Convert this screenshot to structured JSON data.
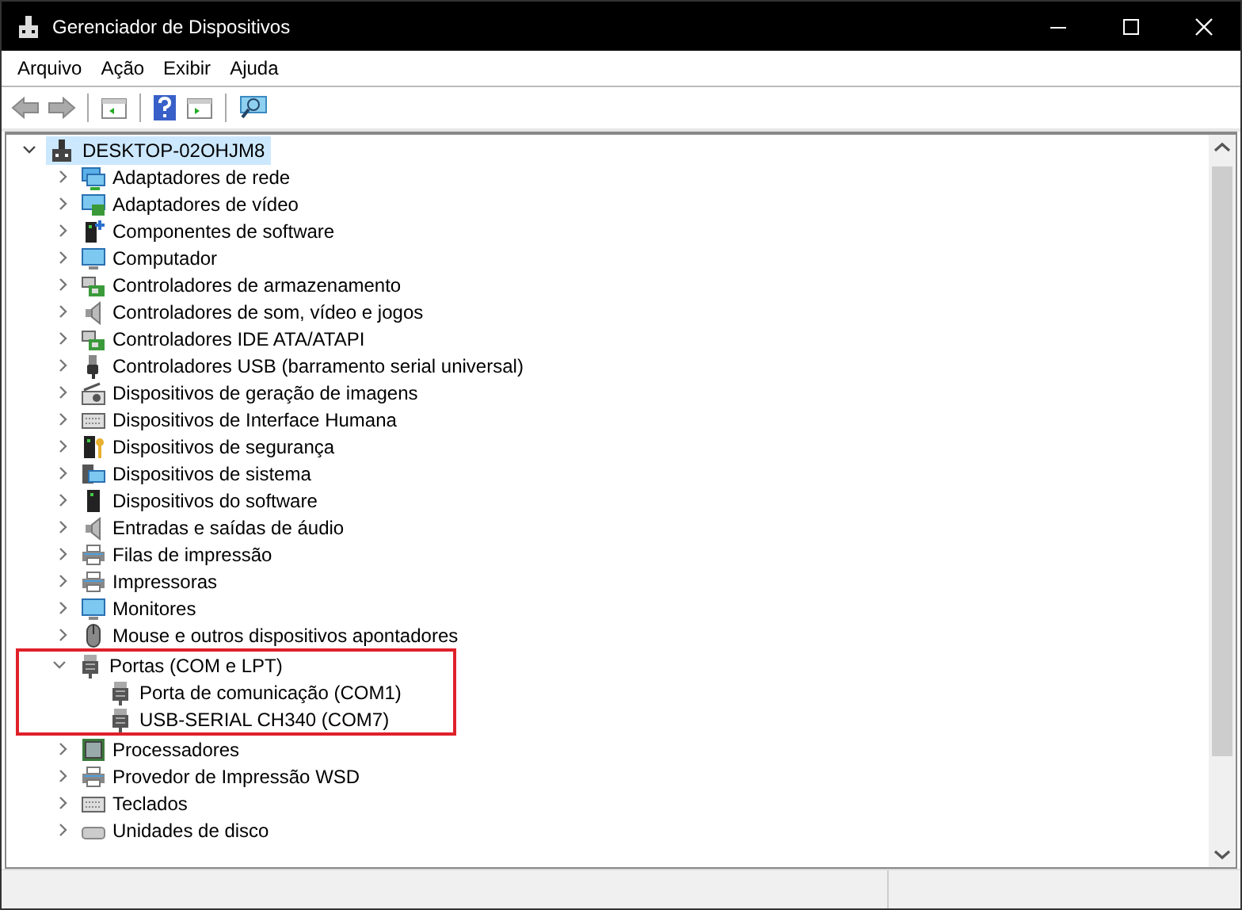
{
  "window": {
    "title": "Gerenciador de Dispositivos"
  },
  "menu": [
    "Arquivo",
    "Ação",
    "Exibir",
    "Ajuda"
  ],
  "tree": {
    "label": "DESKTOP-02OHJM8",
    "selected": true,
    "expanded": true,
    "children": [
      {
        "label": "Adaptadores de rede",
        "kind": "network",
        "expanded": false,
        "highlighted": false
      },
      {
        "label": "Adaptadores de vídeo",
        "kind": "display",
        "expanded": false,
        "highlighted": false
      },
      {
        "label": "Componentes de software",
        "kind": "component",
        "expanded": false,
        "highlighted": false
      },
      {
        "label": "Computador",
        "kind": "monitor",
        "expanded": false,
        "highlighted": false
      },
      {
        "label": "Controladores de armazenamento",
        "kind": "storage",
        "expanded": false,
        "highlighted": false
      },
      {
        "label": "Controladores de som, vídeo e jogos",
        "kind": "speaker",
        "expanded": false,
        "highlighted": false
      },
      {
        "label": "Controladores IDE ATA/ATAPI",
        "kind": "card",
        "expanded": false,
        "highlighted": false
      },
      {
        "label": "Controladores USB (barramento serial universal)",
        "kind": "usb",
        "expanded": false,
        "highlighted": false
      },
      {
        "label": "Dispositivos de geração de imagens",
        "kind": "camera",
        "expanded": false,
        "highlighted": false
      },
      {
        "label": "Dispositivos de Interface Humana",
        "kind": "hid",
        "expanded": false,
        "highlighted": false
      },
      {
        "label": "Dispositivos de segurança",
        "kind": "security",
        "expanded": false,
        "highlighted": false
      },
      {
        "label": "Dispositivos de sistema",
        "kind": "system",
        "expanded": false,
        "highlighted": false
      },
      {
        "label": "Dispositivos do software",
        "kind": "tower",
        "expanded": false,
        "highlighted": false
      },
      {
        "label": "Entradas e saídas de áudio",
        "kind": "speaker",
        "expanded": false,
        "highlighted": false
      },
      {
        "label": "Filas de impressão",
        "kind": "printer",
        "expanded": false,
        "highlighted": false
      },
      {
        "label": "Impressoras",
        "kind": "printer",
        "expanded": false,
        "highlighted": false
      },
      {
        "label": "Monitores",
        "kind": "monitor",
        "expanded": false,
        "highlighted": false
      },
      {
        "label": "Mouse e outros dispositivos apontadores",
        "kind": "mouse",
        "expanded": false,
        "highlighted": false
      },
      {
        "label": "Portas (COM e LPT)",
        "kind": "port",
        "expanded": true,
        "highlighted": true,
        "children": [
          {
            "label": "Porta de comunicação (COM1)",
            "kind": "port"
          },
          {
            "label": "USB-SERIAL CH340 (COM7)",
            "kind": "port"
          }
        ]
      },
      {
        "label": "Processadores",
        "kind": "chip",
        "expanded": false,
        "highlighted": false
      },
      {
        "label": "Provedor de Impressão WSD",
        "kind": "printer",
        "expanded": false,
        "highlighted": false
      },
      {
        "label": "Teclados",
        "kind": "keyboard",
        "expanded": false,
        "highlighted": false
      },
      {
        "label": "Unidades de disco",
        "kind": "drive",
        "expanded": false,
        "highlighted": false
      }
    ]
  }
}
